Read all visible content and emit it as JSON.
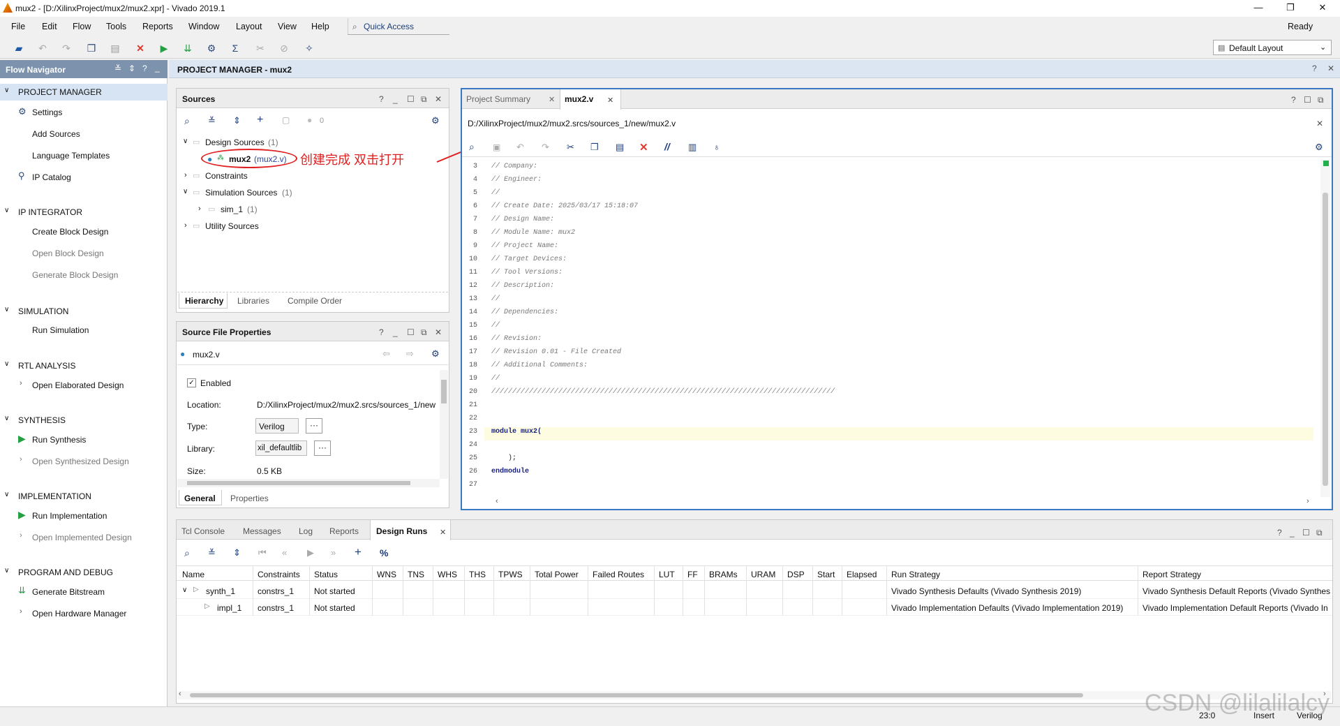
{
  "window": {
    "title": "mux2 - [D:/XilinxProject/mux2/mux2.xpr] - Vivado 2019.1",
    "minimize": "—",
    "restore": "❐",
    "close": "✕"
  },
  "menus": [
    "File",
    "Edit",
    "Flow",
    "Tools",
    "Reports",
    "Window",
    "Layout",
    "View",
    "Help"
  ],
  "quick_access": "Quick Access",
  "status_ready": "Ready",
  "layout_select": "Default Layout",
  "flow_navigator": {
    "title": "Flow Navigator",
    "sections": [
      {
        "name": "PROJECT MANAGER",
        "items": [
          "Settings",
          "Add Sources",
          "Language Templates",
          "IP Catalog"
        ]
      },
      {
        "name": "IP INTEGRATOR",
        "items": [
          "Create Block Design",
          "Open Block Design",
          "Generate Block Design"
        ]
      },
      {
        "name": "SIMULATION",
        "items": [
          "Run Simulation"
        ]
      },
      {
        "name": "RTL ANALYSIS",
        "items": [
          "Open Elaborated Design"
        ]
      },
      {
        "name": "SYNTHESIS",
        "items": [
          "Run Synthesis",
          "Open Synthesized Design"
        ]
      },
      {
        "name": "IMPLEMENTATION",
        "items": [
          "Run Implementation",
          "Open Implemented Design"
        ]
      },
      {
        "name": "PROGRAM AND DEBUG",
        "items": [
          "Generate Bitstream",
          "Open Hardware Manager"
        ]
      }
    ]
  },
  "pm_header": "PROJECT MANAGER - mux2",
  "sources": {
    "title": "Sources",
    "count": "0",
    "tree": {
      "design_sources": "Design Sources",
      "design_sources_count": "(1)",
      "mux2": "mux2",
      "mux2_file": "(mux2.v)",
      "constraints": "Constraints",
      "simulation_sources": "Simulation Sources",
      "simulation_sources_count": "(1)",
      "sim_1": "sim_1",
      "sim_1_count": "(1)",
      "utility_sources": "Utility Sources"
    },
    "tabs": [
      "Hierarchy",
      "Libraries",
      "Compile Order"
    ]
  },
  "annotation": "创建完成 双击打开",
  "props": {
    "title": "Source File Properties",
    "file": "mux2.v",
    "enabled": "Enabled",
    "location_label": "Location:",
    "location": "D:/XilinxProject/mux2/mux2.srcs/sources_1/new",
    "type_label": "Type:",
    "type": "Verilog",
    "library_label": "Library:",
    "library": "xil_defaultlib",
    "size_label": "Size:",
    "size": "0.5 KB",
    "tabs": [
      "General",
      "Properties"
    ]
  },
  "editor": {
    "tabs": [
      "Project Summary",
      "mux2.v"
    ],
    "path": "D:/XilinxProject/mux2/mux2.srcs/sources_1/new/mux2.v",
    "lines": [
      {
        "n": "3",
        "t": "// Company:"
      },
      {
        "n": "4",
        "t": "// Engineer:"
      },
      {
        "n": "5",
        "t": "//"
      },
      {
        "n": "6",
        "t": "// Create Date: 2025/03/17 15:18:07"
      },
      {
        "n": "7",
        "t": "// Design Name:"
      },
      {
        "n": "8",
        "t": "// Module Name: mux2"
      },
      {
        "n": "9",
        "t": "// Project Name:"
      },
      {
        "n": "10",
        "t": "// Target Devices:"
      },
      {
        "n": "11",
        "t": "// Tool Versions:"
      },
      {
        "n": "12",
        "t": "// Description:"
      },
      {
        "n": "13",
        "t": "//"
      },
      {
        "n": "14",
        "t": "// Dependencies:"
      },
      {
        "n": "15",
        "t": "//"
      },
      {
        "n": "16",
        "t": "// Revision:"
      },
      {
        "n": "17",
        "t": "// Revision 0.01 - File Created"
      },
      {
        "n": "18",
        "t": "// Additional Comments:"
      },
      {
        "n": "19",
        "t": "//"
      },
      {
        "n": "20",
        "t": "//////////////////////////////////////////////////////////////////////////////////"
      },
      {
        "n": "21",
        "t": ""
      },
      {
        "n": "22",
        "t": ""
      },
      {
        "n": "23",
        "t": "module mux2("
      },
      {
        "n": "24",
        "t": ""
      },
      {
        "n": "25",
        "t": "    );"
      },
      {
        "n": "26",
        "t": "endmodule"
      },
      {
        "n": "27",
        "t": ""
      }
    ]
  },
  "bottom": {
    "tabs": [
      "Tcl Console",
      "Messages",
      "Log",
      "Reports",
      "Design Runs"
    ],
    "columns": [
      "Name",
      "Constraints",
      "Status",
      "WNS",
      "TNS",
      "WHS",
      "THS",
      "TPWS",
      "Total Power",
      "Failed Routes",
      "LUT",
      "FF",
      "BRAMs",
      "URAM",
      "DSP",
      "Start",
      "Elapsed",
      "Run Strategy",
      "Report Strategy"
    ],
    "rows": [
      {
        "name": "synth_1",
        "constraints": "constrs_1",
        "status": "Not started",
        "run_strategy": "Vivado Synthesis Defaults (Vivado Synthesis 2019)",
        "report_strategy": "Vivado Synthesis Default Reports (Vivado Synthes"
      },
      {
        "name": "impl_1",
        "constraints": "constrs_1",
        "status": "Not started",
        "run_strategy": "Vivado Implementation Defaults (Vivado Implementation 2019)",
        "report_strategy": "Vivado Implementation Default Reports (Vivado In"
      }
    ]
  },
  "statusbar": {
    "pos": "23:0",
    "mode": "Insert",
    "lang": "Verilog",
    "watermark": "CSDN @lilalilalcy"
  }
}
